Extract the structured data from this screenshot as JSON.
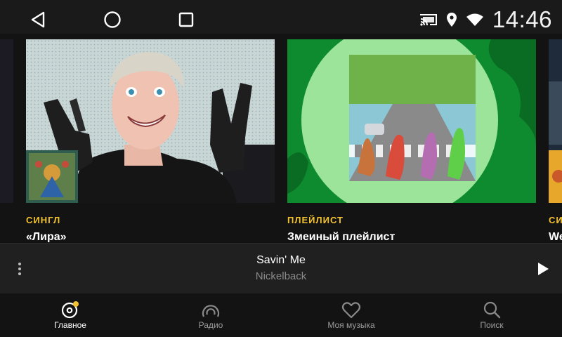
{
  "status_bar": {
    "time": "14:46",
    "icons": [
      "cast-icon",
      "location-icon",
      "wifi-icon"
    ]
  },
  "nav_bar": {
    "buttons": [
      "back-icon",
      "home-icon",
      "recents-icon"
    ]
  },
  "feed": {
    "cards": [
      {
        "type": "СИНГЛ",
        "title": "«Лира»"
      },
      {
        "type": "ПЛЕЙЛИСТ",
        "title": "Змеиный плейлист"
      },
      {
        "type": "СИ",
        "title": "We"
      }
    ]
  },
  "player": {
    "track_title": "Savin' Me",
    "artist": "Nickelback"
  },
  "tabs": [
    {
      "label": "Главное",
      "icon": "home-disc-icon",
      "active": true
    },
    {
      "label": "Радио",
      "icon": "radio-icon",
      "active": false
    },
    {
      "label": "Моя музыка",
      "icon": "heart-icon",
      "active": false
    },
    {
      "label": "Поиск",
      "icon": "search-icon",
      "active": false
    }
  ],
  "colors": {
    "accent": "#f2c230",
    "background": "#131313",
    "player_background": "#202020",
    "muted_text": "#8a8a8a"
  }
}
